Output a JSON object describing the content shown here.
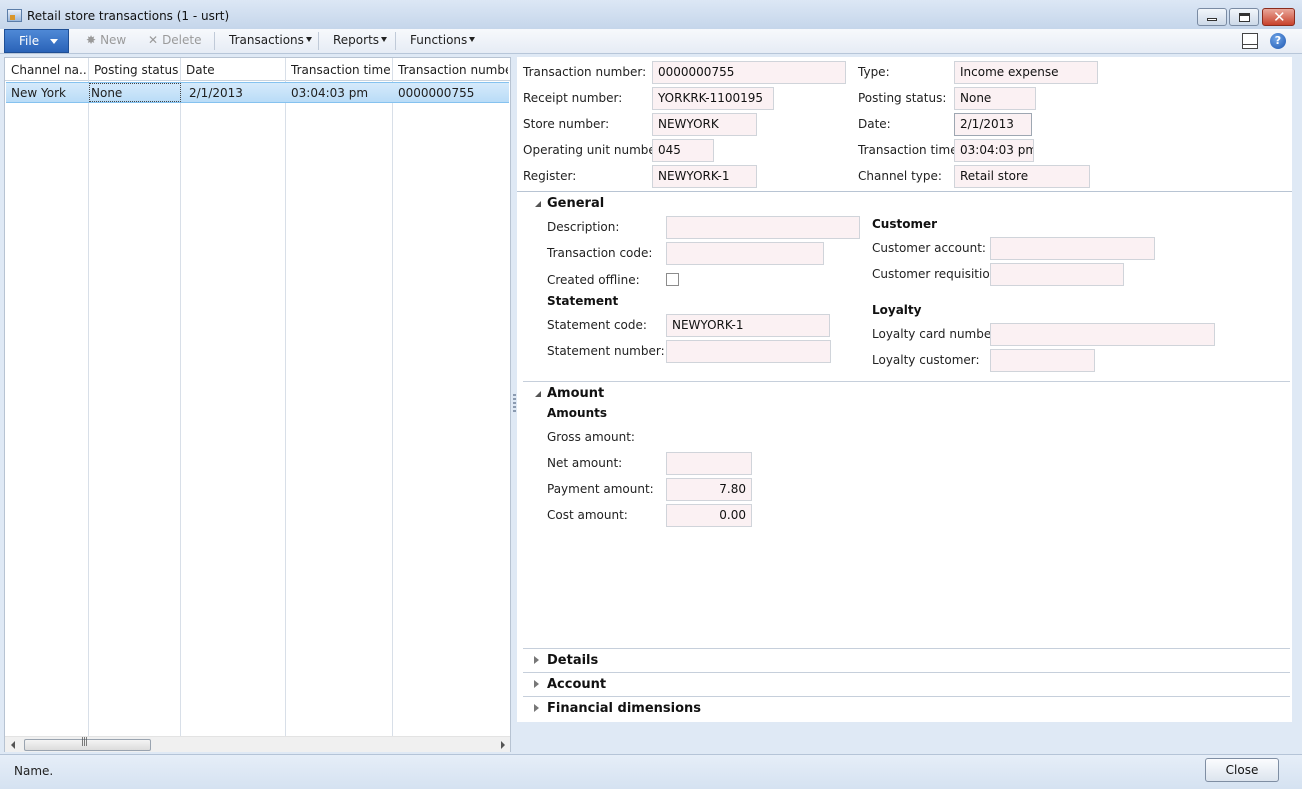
{
  "window": {
    "title": "Retail store transactions (1 - usrt)",
    "minimize_icon": "minimize-icon",
    "maximize_icon": "maximize-icon",
    "close_glyph": "✕"
  },
  "toolbar": {
    "file_label": "File",
    "new_label": "New",
    "delete_label": "Delete",
    "transactions_label": "Transactions",
    "reports_label": "Reports",
    "functions_label": "Functions"
  },
  "grid": {
    "columns": [
      "Channel na...",
      "Posting status",
      "Date",
      "Transaction time",
      "Transaction number"
    ],
    "rows": [
      [
        "New York",
        "None",
        "2/1/2013",
        "03:04:03 pm",
        "0000000755"
      ]
    ]
  },
  "header": {
    "transaction_number_label": "Transaction number:",
    "transaction_number": "0000000755",
    "receipt_number_label": "Receipt number:",
    "receipt_number": "YORKRK-1100195",
    "store_number_label": "Store number:",
    "store_number": "NEWYORK",
    "operating_unit_label": "Operating unit number:",
    "operating_unit": "045",
    "register_label": "Register:",
    "register": "NEWYORK-1",
    "type_label": "Type:",
    "type": "Income expense",
    "posting_status_label": "Posting status:",
    "posting_status": "None",
    "date_label": "Date:",
    "date": "2/1/2013",
    "transaction_time_label": "Transaction time:",
    "transaction_time": "03:04:03 pm",
    "channel_type_label": "Channel type:",
    "channel_type": "Retail store"
  },
  "general": {
    "title": "General",
    "description_label": "Description:",
    "description": "",
    "transaction_code_label": "Transaction code:",
    "transaction_code": "",
    "created_offline_label": "Created offline:",
    "statement_group": "Statement",
    "statement_code_label": "Statement code:",
    "statement_code": "NEWYORK-1",
    "statement_number_label": "Statement number:",
    "statement_number": "",
    "customer_group": "Customer",
    "customer_account_label": "Customer account:",
    "customer_account": "",
    "customer_requisition_label": "Customer requisition:",
    "customer_requisition": "",
    "loyalty_group": "Loyalty",
    "loyalty_card_label": "Loyalty card number:",
    "loyalty_card": "",
    "loyalty_customer_label": "Loyalty customer:",
    "loyalty_customer": ""
  },
  "amount": {
    "title": "Amount",
    "group": "Amounts",
    "gross_label": "Gross amount:",
    "net_label": "Net amount:",
    "net": "",
    "payment_label": "Payment amount:",
    "payment": "7.80",
    "cost_label": "Cost amount:",
    "cost": "0.00"
  },
  "sections": {
    "details": "Details",
    "account": "Account",
    "financial": "Financial dimensions"
  },
  "status": {
    "text": "Name.",
    "close_label": "Close"
  }
}
